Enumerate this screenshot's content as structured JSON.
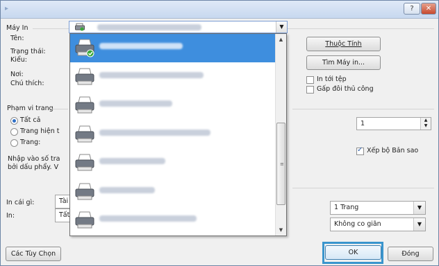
{
  "window": {
    "help_label": "?",
    "close_label": "✕"
  },
  "printer_group": {
    "title": "Máy In",
    "name_label": "Tên:",
    "status_label": "Trạng thái:",
    "type_label": "Kiểu:",
    "where_label": "Nơi:",
    "comment_label": "Chú thích:",
    "properties_button": "Thuộc Tính",
    "find_printer_button": "Tìm Máy in...",
    "print_to_file_label": "In tới tệp",
    "manual_duplex_label": "Gấp đôi thủ công",
    "print_to_file_checked": false,
    "manual_duplex_checked": false
  },
  "page_range_group": {
    "title": "Phạm vi trang",
    "all_label": "Tất cả",
    "current_label": "Trang hiện t",
    "pages_label": "Trang:",
    "hint_line1": "Nhập vào số tra",
    "hint_line2": "bởi dấu phẩy. V",
    "selected": "all"
  },
  "copies_group": {
    "count": "1",
    "collate_label": "Xếp bộ Bản sao",
    "collate_checked": true
  },
  "bottom": {
    "print_what_label": "In cái gì:",
    "print_what_value": "Tài",
    "print_label": "In:",
    "print_value": "Tất",
    "pages_per_sheet": "1 Trang",
    "scale": "Không co giãn",
    "options_button": "Các Tùy Chọn",
    "ok_button": "OK",
    "close_button": "Đóng"
  },
  "printer_dropdown": {
    "items": [
      {
        "name_width": 120,
        "selected": true,
        "status": "ready"
      },
      {
        "name_width": 150,
        "selected": false,
        "status": "none"
      },
      {
        "name_width": 105,
        "selected": false,
        "status": "none"
      },
      {
        "name_width": 160,
        "selected": false,
        "status": "none"
      },
      {
        "name_width": 95,
        "selected": false,
        "status": "none"
      },
      {
        "name_width": 80,
        "selected": false,
        "status": "none"
      },
      {
        "name_width": 140,
        "selected": false,
        "status": "none"
      }
    ]
  },
  "icons": {
    "printer": "printer-icon",
    "ready_badge": "check-badge-icon"
  },
  "colors": {
    "selection": "#3e8ede",
    "ok_highlight": "#3a95cd",
    "ready_badge": "#3aa83a"
  }
}
